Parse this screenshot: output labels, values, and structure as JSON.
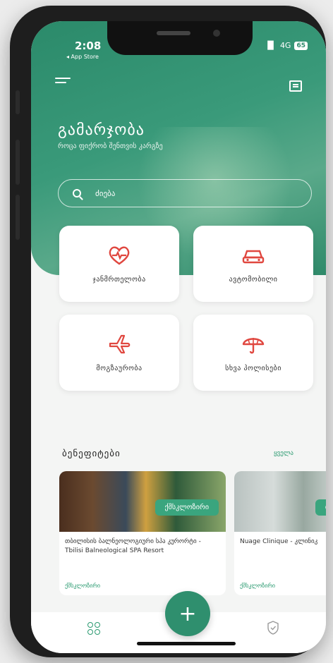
{
  "status": {
    "time": "2:08",
    "back_app": "◂ App Store",
    "network": "4G",
    "battery": "65"
  },
  "header": {
    "greeting": "გამარჯობა",
    "subtitle": "როცა ფიქრობ შენთვის კარგზე",
    "search_placeholder": "ძიება"
  },
  "categories": [
    {
      "label": "ჯანმრთელობა",
      "icon": "heart-pulse-icon"
    },
    {
      "label": "ავტომობილი",
      "icon": "car-icon"
    },
    {
      "label": "მოგზაურობა",
      "icon": "plane-icon"
    },
    {
      "label": "სხვა პოლისები",
      "icon": "umbrella-icon"
    }
  ],
  "benefits": {
    "title": "ბენეფიტები",
    "see_all": "ყველა",
    "items": [
      {
        "tag": "ქშსკლოზირი",
        "text": "თბილისის ბალნეოლოგიური სპა კურორტი - Tbilisi Balneological SPA Resort",
        "link": "ქშსკლოზირი"
      },
      {
        "tag": "ბ",
        "text": "Nuage Clinique - კლინიკ",
        "link": "ქშსკლოზირი"
      }
    ]
  },
  "tabbar": {
    "fab_label": "+"
  },
  "colors": {
    "brand": "#2f8f6e",
    "accent_red": "#e0473f"
  }
}
